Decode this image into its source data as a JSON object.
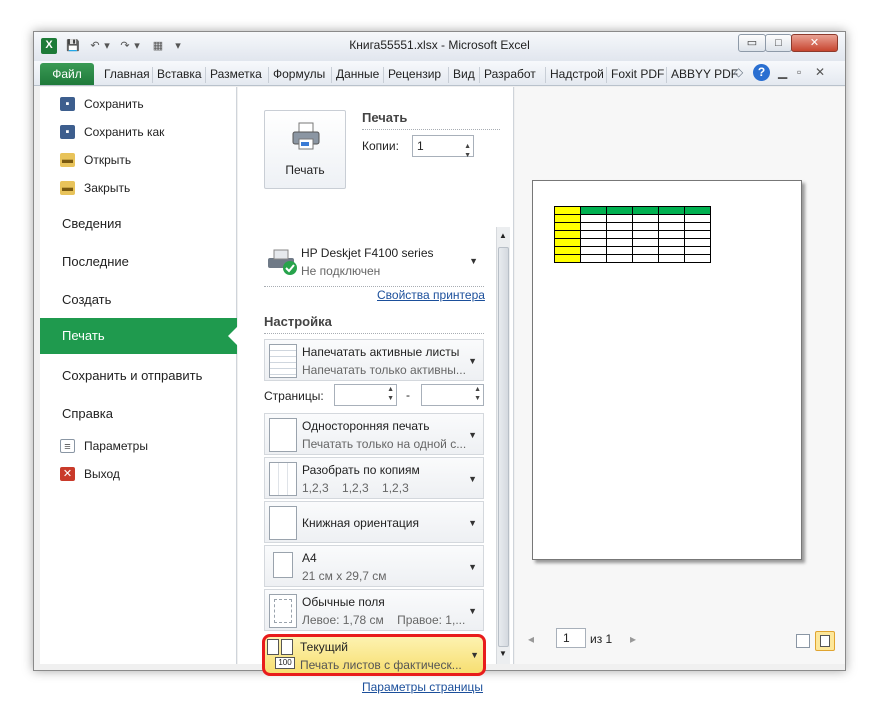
{
  "window": {
    "title": "Книга55551.xlsx - Microsoft Excel",
    "controls": {
      "minimize": "▭",
      "maximize": "□",
      "close": "✕"
    }
  },
  "quick_access": {
    "logo": "X",
    "save": "💾",
    "undo": "↶",
    "undo_drop": "▾",
    "redo": "↷",
    "redo_drop": "▾",
    "misc": "▦",
    "more": "▾"
  },
  "ribbon": {
    "file_tab": "Файл",
    "tabs": [
      "Главная",
      "Вставка",
      "Разметка",
      "Формулы",
      "Данные",
      "Рецензир",
      "Вид",
      "Разработ",
      "Надстрой",
      "Foxit PDF",
      "ABBYY PDF"
    ],
    "icons": {
      "minimize_ribbon": "◇",
      "help": "?",
      "restore": "▫",
      "close": "✕"
    }
  },
  "left_nav": {
    "save": "Сохранить",
    "save_as": "Сохранить как",
    "open": "Открыть",
    "close": "Закрыть",
    "info": "Сведения",
    "recent": "Последние",
    "new": "Создать",
    "print": "Печать",
    "save_send": "Сохранить и отправить",
    "help": "Справка",
    "options": "Параметры",
    "exit": "Выход"
  },
  "print_panel": {
    "print_button": "Печать",
    "header": "Печать",
    "copies_label": "Копии:",
    "copies_value": "1",
    "printer_name": "HP Deskjet F4100 series",
    "printer_status": "Не подключен",
    "printer_props": "Свойства принтера",
    "settings_header": "Настройка",
    "what": {
      "title": "Напечатать активные листы",
      "sub": "Напечатать только активны..."
    },
    "pages_label": "Страницы:",
    "pages_dash": "-",
    "sides": {
      "title": "Односторонняя печать",
      "sub": "Печатать только на одной с..."
    },
    "collate": {
      "title": "Разобрать по копиям",
      "sub": "1,2,3    1,2,3    1,2,3"
    },
    "orientation": {
      "title": "Книжная ориентация"
    },
    "paper": {
      "title": "A4",
      "sub": "21 см x 29,7 см"
    },
    "margins": {
      "title": "Обычные поля",
      "sub": "Левое: 1,78 см    Правое: 1,..."
    },
    "scaling": {
      "title": "Текущий",
      "sub": "Печать листов с фактическ...",
      "badge": "100"
    },
    "page_setup": "Параметры страницы"
  },
  "preview": {
    "page_current": "1",
    "page_of": "из 1",
    "prev": "◂",
    "next": "▸"
  },
  "colors": {
    "accent": "#1f9a4e",
    "highlight": "#e81c1c",
    "selected_bg": "#fbe98a"
  }
}
